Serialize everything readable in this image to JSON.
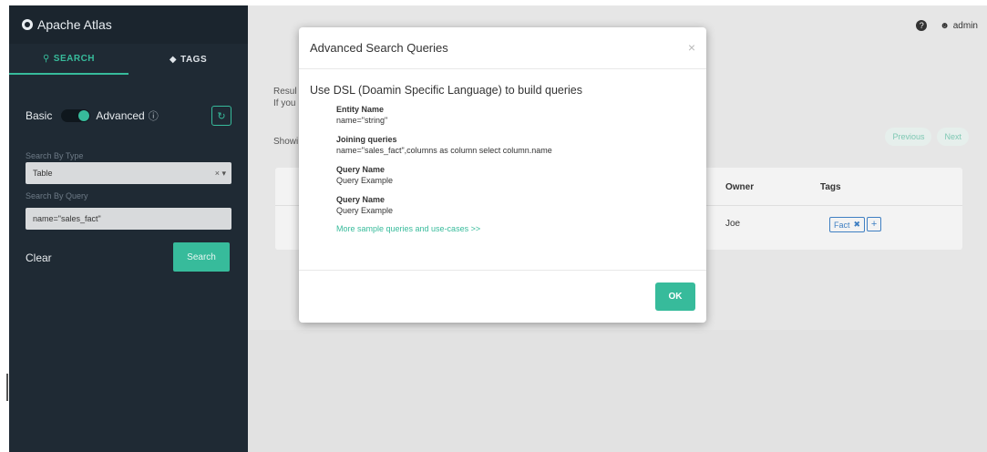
{
  "app": {
    "title": "Apache Atlas"
  },
  "sidebar": {
    "tabs": [
      {
        "label": "SEARCH",
        "icon": "search-icon"
      },
      {
        "label": "TAGS",
        "icon": "tag-icon"
      }
    ],
    "toggle": {
      "left_label": "Basic",
      "right_label": "Advanced",
      "mode": "Advanced"
    },
    "search_by_type": {
      "label": "Search By Type",
      "value": "Table"
    },
    "search_by_query": {
      "label": "Search By Query",
      "value": "name=\"sales_fact\""
    },
    "clear_label": "Clear",
    "search_label": "Search"
  },
  "header": {
    "user": "admin"
  },
  "main": {
    "results_line1": "Resul",
    "results_line2": "If you",
    "showing": "Showi",
    "pager": {
      "previous": "Previous",
      "next": "Next"
    },
    "table": {
      "headers": {
        "owner": "Owner",
        "tags": "Tags"
      },
      "rows": [
        {
          "owner": "Joe",
          "tag": "Fact"
        }
      ]
    }
  },
  "modal": {
    "title": "Advanced Search Queries",
    "close": "×",
    "intro": "Use DSL (Doamin Specific Language) to build queries",
    "entries": [
      {
        "name": "Entity Name",
        "value": "name=\"string\""
      },
      {
        "name": "Joining queries",
        "value": "name=\"sales_fact\",columns as column select column.name"
      },
      {
        "name": "Query Name",
        "value": "Query Example"
      },
      {
        "name": "Query Name",
        "value": "Query Example"
      }
    ],
    "more_link": "More sample queries and use-cases >>",
    "ok": "OK"
  },
  "colors": {
    "accent": "#37bb9b",
    "sidebar": "#1f2a34",
    "tag": "#3f7fc2"
  }
}
